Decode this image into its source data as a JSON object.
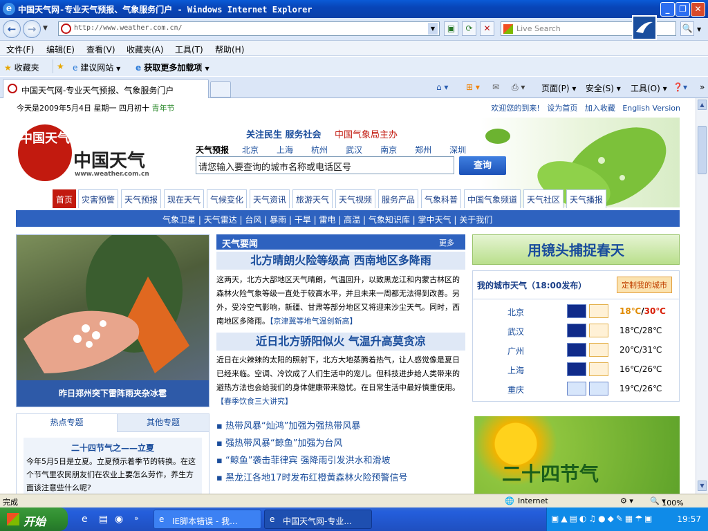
{
  "window": {
    "title": "中国天气网-专业天气预报、气象服务门户 - Windows Internet Explorer",
    "buttons": [
      "_",
      "❐",
      "✕"
    ]
  },
  "addressbar": {
    "url": "http://www.weather.com.cn/",
    "search_placeholder": "Live Search"
  },
  "menubar": [
    "文件(F)",
    "编辑(E)",
    "查看(V)",
    "收藏夹(A)",
    "工具(T)",
    "帮助(H)"
  ],
  "favbar": {
    "favorites": "收藏夹",
    "suggested": "建议网站",
    "addons": "获取更多加载项"
  },
  "tabs": {
    "active_label": "中国天气网-专业天气预报、气象服务门户",
    "commands": {
      "page": "页面(P)",
      "safety": "安全(S)",
      "tools": "工具(O)"
    }
  },
  "site": {
    "date_text": "今天是2009年5月4日 星期一 四月初十",
    "holiday": "青年节",
    "top_links": [
      "欢迎您的到来!",
      "设为首页",
      "加入收藏",
      "English Version"
    ],
    "logo_cn": "中国天气",
    "logo_seal": "中国天气",
    "logo_url": "www.weather.com.cn",
    "slogan1": "关注民生 服务社会",
    "slogan2": "中国气象局主办",
    "forecast_label": "天气预报",
    "cities": [
      "北京",
      "上海",
      "杭州",
      "武汉",
      "南京",
      "郑州",
      "深圳"
    ],
    "search_placeholder": "请您输入要查询的城市名称或电话区号",
    "search_button": "查询",
    "nav": [
      "首页",
      "灾害预警",
      "天气预报",
      "现在天气",
      "气候变化",
      "天气资讯",
      "旅游天气",
      "天气视频",
      "服务产品",
      "气象科普",
      "中国气象频道",
      "天气社区",
      "天气播报"
    ],
    "subnav": [
      "气象卫星",
      "天气雷达",
      "台风",
      "暴雨",
      "干旱",
      "雷电",
      "高温",
      "气象知识库",
      "掌中天气",
      "关于我们"
    ],
    "photo_caption": "昨日郑州突下雷阵雨夹杂冰雹",
    "news": {
      "header": "天气要闻",
      "more": "更多",
      "headline1": "北方晴朗火险等级高 西南地区多降雨",
      "body1": "这两天，北方大部地区天气晴朗，气温回升，以致黑龙江和内蒙古林区的森林火险气象等级一直处于较高水平，并且未来一周都无法得到改善。另外，受冷空气影响，新疆、甘肃等部分地区又将迎来沙尘天气。同时，西南地区多降雨。",
      "link1": "【京津冀等地气温创新高】",
      "headline2": "近日北方骄阳似火 气温升高莫贪凉",
      "body2": "近日在火辣辣的太阳的照射下，北方大地蒸腾着热气，让人感觉像是夏日已经来临。空调、冷饮成了人们生活中的宠儿。但科技进步给人类带来的避热方法也会给我们的身体健康带来隐忧。在日常生活中最好慎重使用。",
      "link2": "【春季饮食三大讲究】",
      "items": [
        "热带风暴“灿鸿”加强为强热带风暴",
        "强热带风暴“鲸鱼”加强为台风",
        "“鲸鱼”袭击菲律宾 强降雨引发洪水和滑坡",
        "黑龙江各地17时发布红橙黄森林火险预警信号"
      ]
    },
    "spring_banner": "用镜头捕捉春天",
    "my_city": {
      "title": "我的城市天气（18:00发布）",
      "button": "定制我的城市",
      "rows": [
        {
          "city": "北京",
          "temp_low": "18℃",
          "sep": "/",
          "temp_high": "30℃",
          "night": "moon",
          "day": "sun"
        },
        {
          "city": "武汉",
          "temp": "18℃/28℃",
          "night": "moon",
          "day": "cloud-sun"
        },
        {
          "city": "广州",
          "temp": "20℃/31℃",
          "night": "moon",
          "day": "cloud-sun"
        },
        {
          "city": "上海",
          "temp": "16℃/26℃",
          "night": "moon",
          "day": "sun"
        },
        {
          "city": "重庆",
          "temp": "19℃/26℃",
          "night": "rain",
          "day": "rain"
        }
      ]
    },
    "topic_tabs": [
      "热点专题",
      "其他专题"
    ],
    "topic_title": "二十四节气之——立夏",
    "topic_body": "今年5月5日是立夏。立夏预示着季节的转换。在这个节气里农民朋友们在农业上要怎么劳作，养生方面该注意些什么呢?",
    "solar_banner": "二十四节气"
  },
  "statusbar": {
    "status": "完成",
    "zone": "Internet",
    "zoom": "100%"
  },
  "taskbar": {
    "start": "开始",
    "items": [
      "IE脚本错误 - 我...",
      "中国天气网-专业..."
    ],
    "clock": "19:57"
  },
  "colors": {
    "brand_red": "#c21a0f",
    "brand_blue": "#2e62bf",
    "title_blue": "#0a3fa8"
  }
}
